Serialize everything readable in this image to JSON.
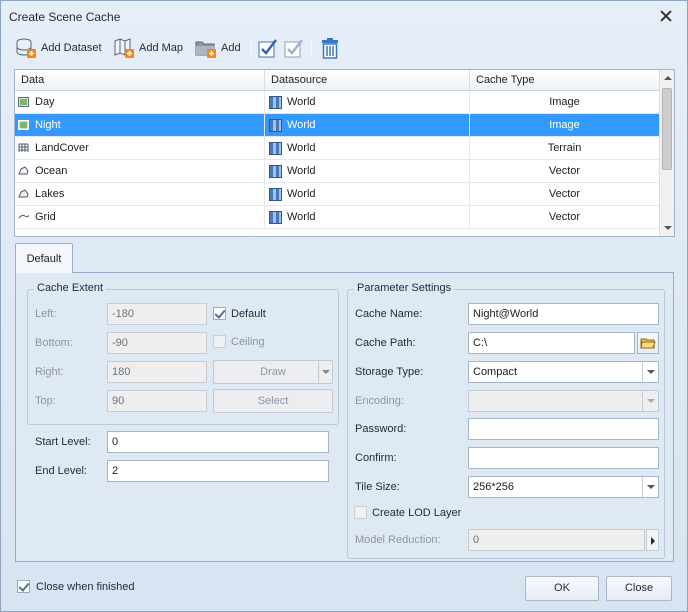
{
  "window": {
    "title": "Create Scene Cache"
  },
  "toolbar": {
    "add_dataset": "Add Dataset",
    "add_map": "Add Map",
    "add": "Add",
    "icons": [
      "database-add-icon",
      "map-add-icon",
      "folder-add-icon",
      "select-all-icon",
      "select-invert-icon",
      "delete-icon"
    ]
  },
  "table": {
    "columns": [
      "Data",
      "Datasource",
      "Cache Type"
    ],
    "rows": [
      {
        "data": "Day",
        "datasource": "World",
        "cache_type": "Image",
        "icon": "image-dataset-icon"
      },
      {
        "data": "Night",
        "datasource": "World",
        "cache_type": "Image",
        "icon": "image-dataset-icon",
        "selected": true
      },
      {
        "data": "LandCover",
        "datasource": "World",
        "cache_type": "Terrain",
        "icon": "grid-dataset-icon"
      },
      {
        "data": "Ocean",
        "datasource": "World",
        "cache_type": "Vector",
        "icon": "region-dataset-icon"
      },
      {
        "data": "Lakes",
        "datasource": "World",
        "cache_type": "Vector",
        "icon": "region-dataset-icon"
      },
      {
        "data": "Grid",
        "datasource": "World",
        "cache_type": "Vector",
        "icon": "line-dataset-icon"
      }
    ]
  },
  "tab": {
    "default": "Default"
  },
  "cache_extent": {
    "title": "Cache Extent",
    "left_label": "Left:",
    "left_value": "-180",
    "bottom_label": "Bottom:",
    "bottom_value": "-90",
    "right_label": "Right:",
    "right_value": "180",
    "top_label": "Top:",
    "top_value": "90",
    "default_label": "Default",
    "ceiling_label": "Ceiling",
    "draw_label": "Draw",
    "select_label": "Select"
  },
  "levels": {
    "start_label": "Start Level:",
    "start_value": "0",
    "end_label": "End Level:",
    "end_value": "2"
  },
  "params": {
    "title": "Parameter Settings",
    "cache_name_label": "Cache Name:",
    "cache_name_value": "Night@World",
    "cache_path_label": "Cache Path:",
    "cache_path_value": "C:\\",
    "storage_type_label": "Storage Type:",
    "storage_type_value": "Compact",
    "encoding_label": "Encoding:",
    "encoding_value": "",
    "password_label": "Password:",
    "confirm_label": "Confirm:",
    "tile_size_label": "Tile Size:",
    "tile_size_value": "256*256",
    "create_lod_label": "Create LOD Layer",
    "model_reduction_label": "Model Reduction:",
    "model_reduction_value": "0"
  },
  "footer": {
    "close_when_finished": "Close when finished",
    "ok": "OK",
    "close": "Close"
  }
}
